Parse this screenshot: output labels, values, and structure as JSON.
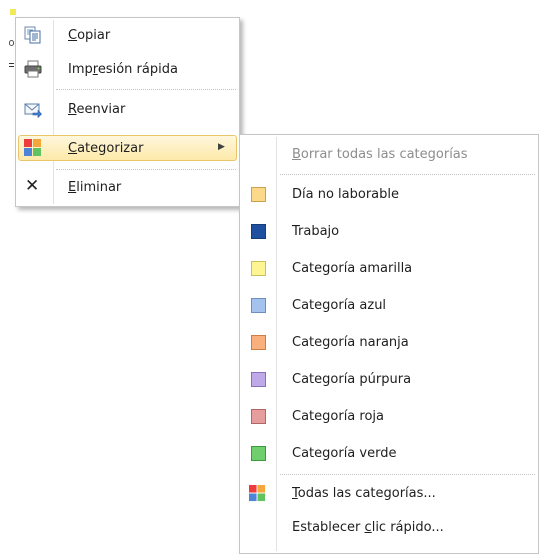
{
  "main_menu": {
    "items": [
      {
        "label": "Copiar",
        "mnemonic": "C"
      },
      {
        "label": "Impresión rápida",
        "mnemonic": "r"
      },
      {
        "label": "Reenviar",
        "mnemonic": "R"
      },
      {
        "label": "Categorizar",
        "mnemonic": "C",
        "submenu_arrow": "▶"
      },
      {
        "label": "Eliminar",
        "mnemonic": "E",
        "icon_glyph": "✕"
      }
    ]
  },
  "category_menu": {
    "clear_all": {
      "label": "Borrar todas las categorías",
      "mnemonic": "B"
    },
    "categories": [
      {
        "label": "Día no laborable",
        "color": "#fbd88a",
        "border": "#c9a24c"
      },
      {
        "label": "Trabajo",
        "color": "#1f4f9f",
        "border": "#173c7a"
      },
      {
        "label": "Categoría amarilla",
        "color": "#fdf593",
        "border": "#c9c25c"
      },
      {
        "label": "Categoría azul",
        "color": "#a4c2ec",
        "border": "#6d8fc0"
      },
      {
        "label": "Categoría naranja",
        "color": "#f9b07d",
        "border": "#cc7e46"
      },
      {
        "label": "Categoría púrpura",
        "color": "#c0a9e7",
        "border": "#8a70b8"
      },
      {
        "label": "Categoría roja",
        "color": "#e59d9d",
        "border": "#b46464"
      },
      {
        "label": "Categoría verde",
        "color": "#6fcf6f",
        "border": "#3c993c"
      }
    ],
    "all_categories": {
      "label": "Todas las categorías...",
      "mnemonic": "T"
    },
    "quick_click": {
      "label": "Establecer clic rápido...",
      "mnemonic": "c"
    }
  },
  "colors": {
    "highlight_top": "#fef7de",
    "highlight_bottom": "#fde9a8",
    "highlight_border": "#e8c669",
    "menu_border": "#c6c6c6",
    "disabled_text": "#8d8d8d"
  }
}
